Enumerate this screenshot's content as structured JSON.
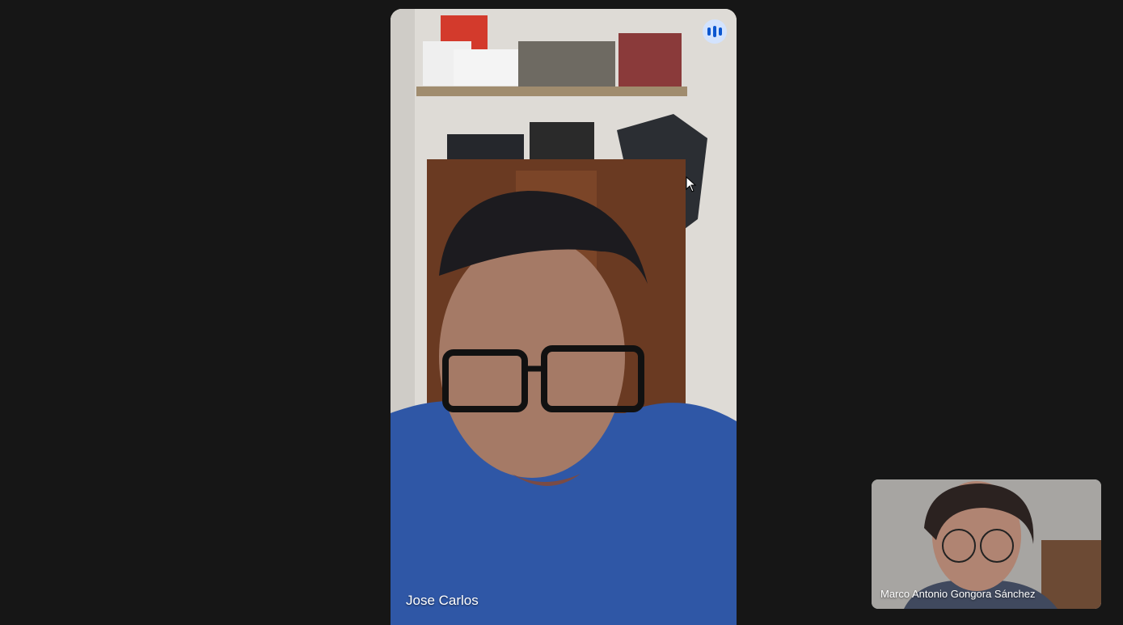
{
  "main_participant": {
    "name": "Jose Carlos",
    "speaking_icon": "audio-level-icon"
  },
  "self_view": {
    "name": "Marco Antonio Gongora Sánchez"
  },
  "colors": {
    "background": "#161616",
    "speaking_badge_bg": "#d3e3fd",
    "speaking_badge_fg": "#0b57d0",
    "label_text": "#ffffff"
  }
}
